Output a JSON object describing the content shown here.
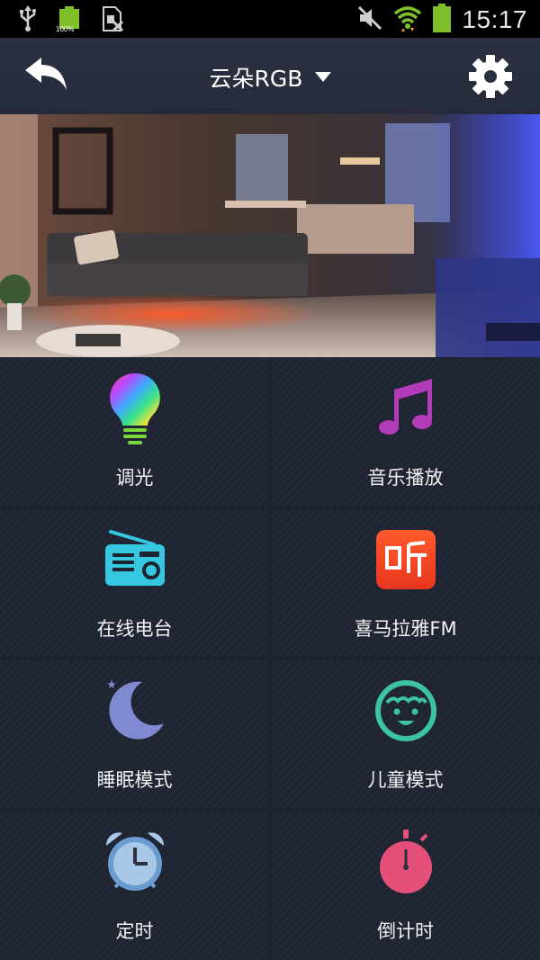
{
  "status_bar": {
    "battery_small_label": "100%",
    "time": "15:17"
  },
  "header": {
    "title": "云朵RGB"
  },
  "colors": {
    "header_bg": "#2a3040",
    "grid_bg": "#1f2433",
    "tile_divider": "#141824"
  },
  "tiles": [
    {
      "label": "调光",
      "icon": "rainbow-bulb-icon"
    },
    {
      "label": "音乐播放",
      "icon": "music-note-icon"
    },
    {
      "label": "在线电台",
      "icon": "radio-icon"
    },
    {
      "label": "喜马拉雅FM",
      "icon": "ximalaya-logo-icon"
    },
    {
      "label": "睡眠模式",
      "icon": "moon-star-icon"
    },
    {
      "label": "儿童模式",
      "icon": "child-face-icon"
    },
    {
      "label": "定时",
      "icon": "alarm-clock-icon"
    },
    {
      "label": "倒计时",
      "icon": "stopwatch-icon"
    }
  ]
}
